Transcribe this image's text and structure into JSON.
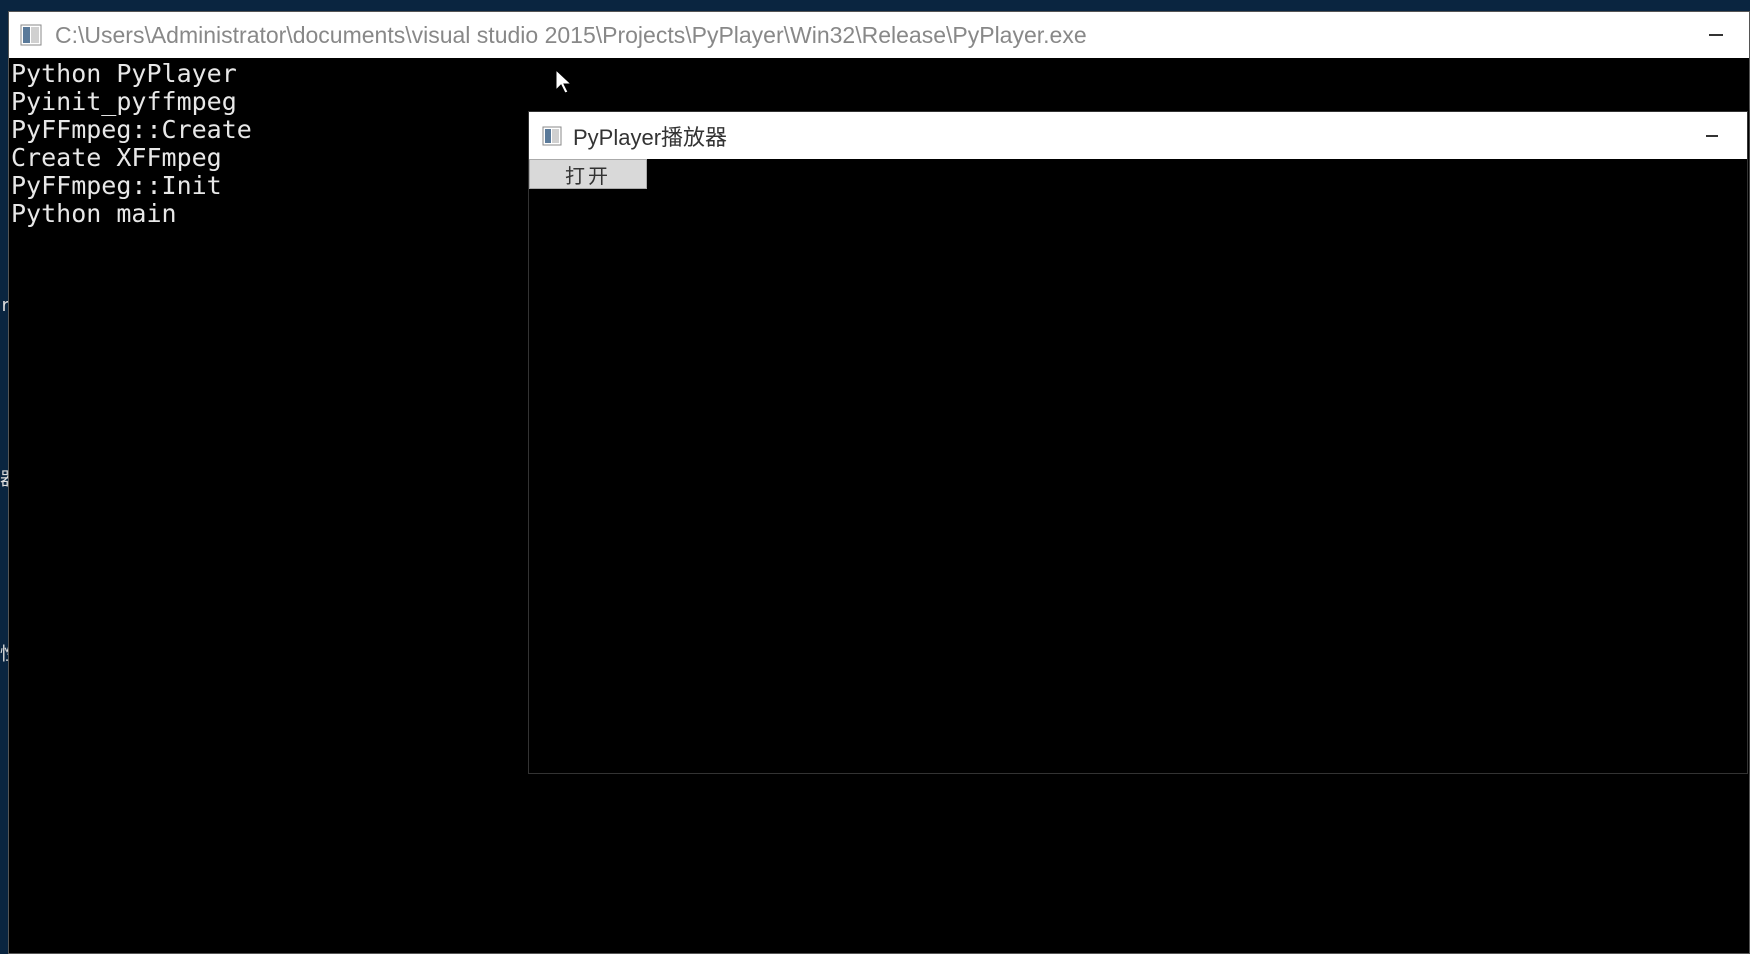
{
  "console": {
    "title": "C:\\Users\\Administrator\\documents\\visual studio 2015\\Projects\\PyPlayer\\Win32\\Release\\PyPlayer.exe",
    "lines": [
      "Python PyPlayer",
      "Pyinit_pyffmpeg",
      "PyFFmpeg::Create",
      "Create XFFmpeg",
      "PyFFmpeg::Init",
      "Python main"
    ]
  },
  "player": {
    "title": "PyPlayer播放器",
    "open_label": "打开"
  }
}
